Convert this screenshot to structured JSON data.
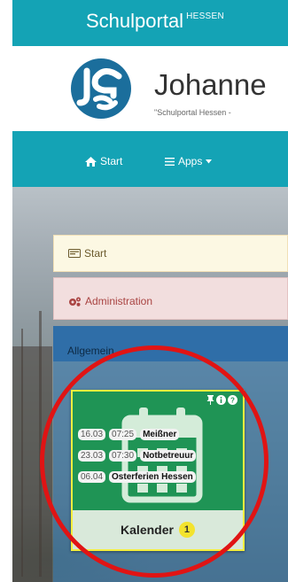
{
  "brand": {
    "title": "Schulportal",
    "superscript": "HESSEN",
    "color": "#14a3b5"
  },
  "school": {
    "name": "Johanne",
    "subtitle": "\"Schulportal Hessen -",
    "logo_icon": "jgs-logo"
  },
  "nav": {
    "items": [
      {
        "label": "Start",
        "icon": "home-icon"
      },
      {
        "label": "Apps",
        "icon": "menu-icon",
        "has_dropdown": true
      }
    ]
  },
  "menu": {
    "start": {
      "label": "Start",
      "icon": "start-icon"
    },
    "admin": {
      "label": "Administration",
      "icon": "cogs-icon"
    },
    "allgemein": {
      "label": "Allgemein"
    }
  },
  "calendar_tile": {
    "name": "Kalender",
    "badge_count": "1",
    "border_color": "#f5ef3e",
    "background_color": "#1f9455",
    "header_icons": [
      "pin-icon",
      "info-icon",
      "help-icon"
    ],
    "events": [
      {
        "date": "16.03",
        "time": "07:25",
        "title": "Meißner"
      },
      {
        "date": "23.03",
        "time": "07:30",
        "title": "Notbetreuur"
      },
      {
        "date": "06.04",
        "title": "Osterferien Hessen"
      }
    ]
  }
}
